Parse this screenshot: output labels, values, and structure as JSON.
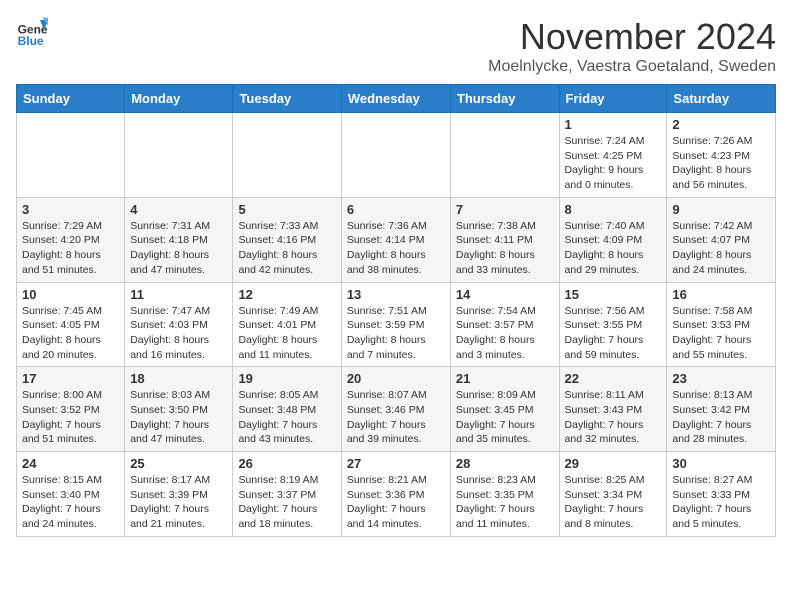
{
  "logo": {
    "line1": "General",
    "line2": "Blue"
  },
  "title": "November 2024",
  "subtitle": "Moelnlycke, Vaestra Goetaland, Sweden",
  "days_of_week": [
    "Sunday",
    "Monday",
    "Tuesday",
    "Wednesday",
    "Thursday",
    "Friday",
    "Saturday"
  ],
  "weeks": [
    [
      {
        "day": "",
        "info": ""
      },
      {
        "day": "",
        "info": ""
      },
      {
        "day": "",
        "info": ""
      },
      {
        "day": "",
        "info": ""
      },
      {
        "day": "",
        "info": ""
      },
      {
        "day": "1",
        "info": "Sunrise: 7:24 AM\nSunset: 4:25 PM\nDaylight: 9 hours\nand 0 minutes."
      },
      {
        "day": "2",
        "info": "Sunrise: 7:26 AM\nSunset: 4:23 PM\nDaylight: 8 hours\nand 56 minutes."
      }
    ],
    [
      {
        "day": "3",
        "info": "Sunrise: 7:29 AM\nSunset: 4:20 PM\nDaylight: 8 hours\nand 51 minutes."
      },
      {
        "day": "4",
        "info": "Sunrise: 7:31 AM\nSunset: 4:18 PM\nDaylight: 8 hours\nand 47 minutes."
      },
      {
        "day": "5",
        "info": "Sunrise: 7:33 AM\nSunset: 4:16 PM\nDaylight: 8 hours\nand 42 minutes."
      },
      {
        "day": "6",
        "info": "Sunrise: 7:36 AM\nSunset: 4:14 PM\nDaylight: 8 hours\nand 38 minutes."
      },
      {
        "day": "7",
        "info": "Sunrise: 7:38 AM\nSunset: 4:11 PM\nDaylight: 8 hours\nand 33 minutes."
      },
      {
        "day": "8",
        "info": "Sunrise: 7:40 AM\nSunset: 4:09 PM\nDaylight: 8 hours\nand 29 minutes."
      },
      {
        "day": "9",
        "info": "Sunrise: 7:42 AM\nSunset: 4:07 PM\nDaylight: 8 hours\nand 24 minutes."
      }
    ],
    [
      {
        "day": "10",
        "info": "Sunrise: 7:45 AM\nSunset: 4:05 PM\nDaylight: 8 hours\nand 20 minutes."
      },
      {
        "day": "11",
        "info": "Sunrise: 7:47 AM\nSunset: 4:03 PM\nDaylight: 8 hours\nand 16 minutes."
      },
      {
        "day": "12",
        "info": "Sunrise: 7:49 AM\nSunset: 4:01 PM\nDaylight: 8 hours\nand 11 minutes."
      },
      {
        "day": "13",
        "info": "Sunrise: 7:51 AM\nSunset: 3:59 PM\nDaylight: 8 hours\nand 7 minutes."
      },
      {
        "day": "14",
        "info": "Sunrise: 7:54 AM\nSunset: 3:57 PM\nDaylight: 8 hours\nand 3 minutes."
      },
      {
        "day": "15",
        "info": "Sunrise: 7:56 AM\nSunset: 3:55 PM\nDaylight: 7 hours\nand 59 minutes."
      },
      {
        "day": "16",
        "info": "Sunrise: 7:58 AM\nSunset: 3:53 PM\nDaylight: 7 hours\nand 55 minutes."
      }
    ],
    [
      {
        "day": "17",
        "info": "Sunrise: 8:00 AM\nSunset: 3:52 PM\nDaylight: 7 hours\nand 51 minutes."
      },
      {
        "day": "18",
        "info": "Sunrise: 8:03 AM\nSunset: 3:50 PM\nDaylight: 7 hours\nand 47 minutes."
      },
      {
        "day": "19",
        "info": "Sunrise: 8:05 AM\nSunset: 3:48 PM\nDaylight: 7 hours\nand 43 minutes."
      },
      {
        "day": "20",
        "info": "Sunrise: 8:07 AM\nSunset: 3:46 PM\nDaylight: 7 hours\nand 39 minutes."
      },
      {
        "day": "21",
        "info": "Sunrise: 8:09 AM\nSunset: 3:45 PM\nDaylight: 7 hours\nand 35 minutes."
      },
      {
        "day": "22",
        "info": "Sunrise: 8:11 AM\nSunset: 3:43 PM\nDaylight: 7 hours\nand 32 minutes."
      },
      {
        "day": "23",
        "info": "Sunrise: 8:13 AM\nSunset: 3:42 PM\nDaylight: 7 hours\nand 28 minutes."
      }
    ],
    [
      {
        "day": "24",
        "info": "Sunrise: 8:15 AM\nSunset: 3:40 PM\nDaylight: 7 hours\nand 24 minutes."
      },
      {
        "day": "25",
        "info": "Sunrise: 8:17 AM\nSunset: 3:39 PM\nDaylight: 7 hours\nand 21 minutes."
      },
      {
        "day": "26",
        "info": "Sunrise: 8:19 AM\nSunset: 3:37 PM\nDaylight: 7 hours\nand 18 minutes."
      },
      {
        "day": "27",
        "info": "Sunrise: 8:21 AM\nSunset: 3:36 PM\nDaylight: 7 hours\nand 14 minutes."
      },
      {
        "day": "28",
        "info": "Sunrise: 8:23 AM\nSunset: 3:35 PM\nDaylight: 7 hours\nand 11 minutes."
      },
      {
        "day": "29",
        "info": "Sunrise: 8:25 AM\nSunset: 3:34 PM\nDaylight: 7 hours\nand 8 minutes."
      },
      {
        "day": "30",
        "info": "Sunrise: 8:27 AM\nSunset: 3:33 PM\nDaylight: 7 hours\nand 5 minutes."
      }
    ]
  ]
}
